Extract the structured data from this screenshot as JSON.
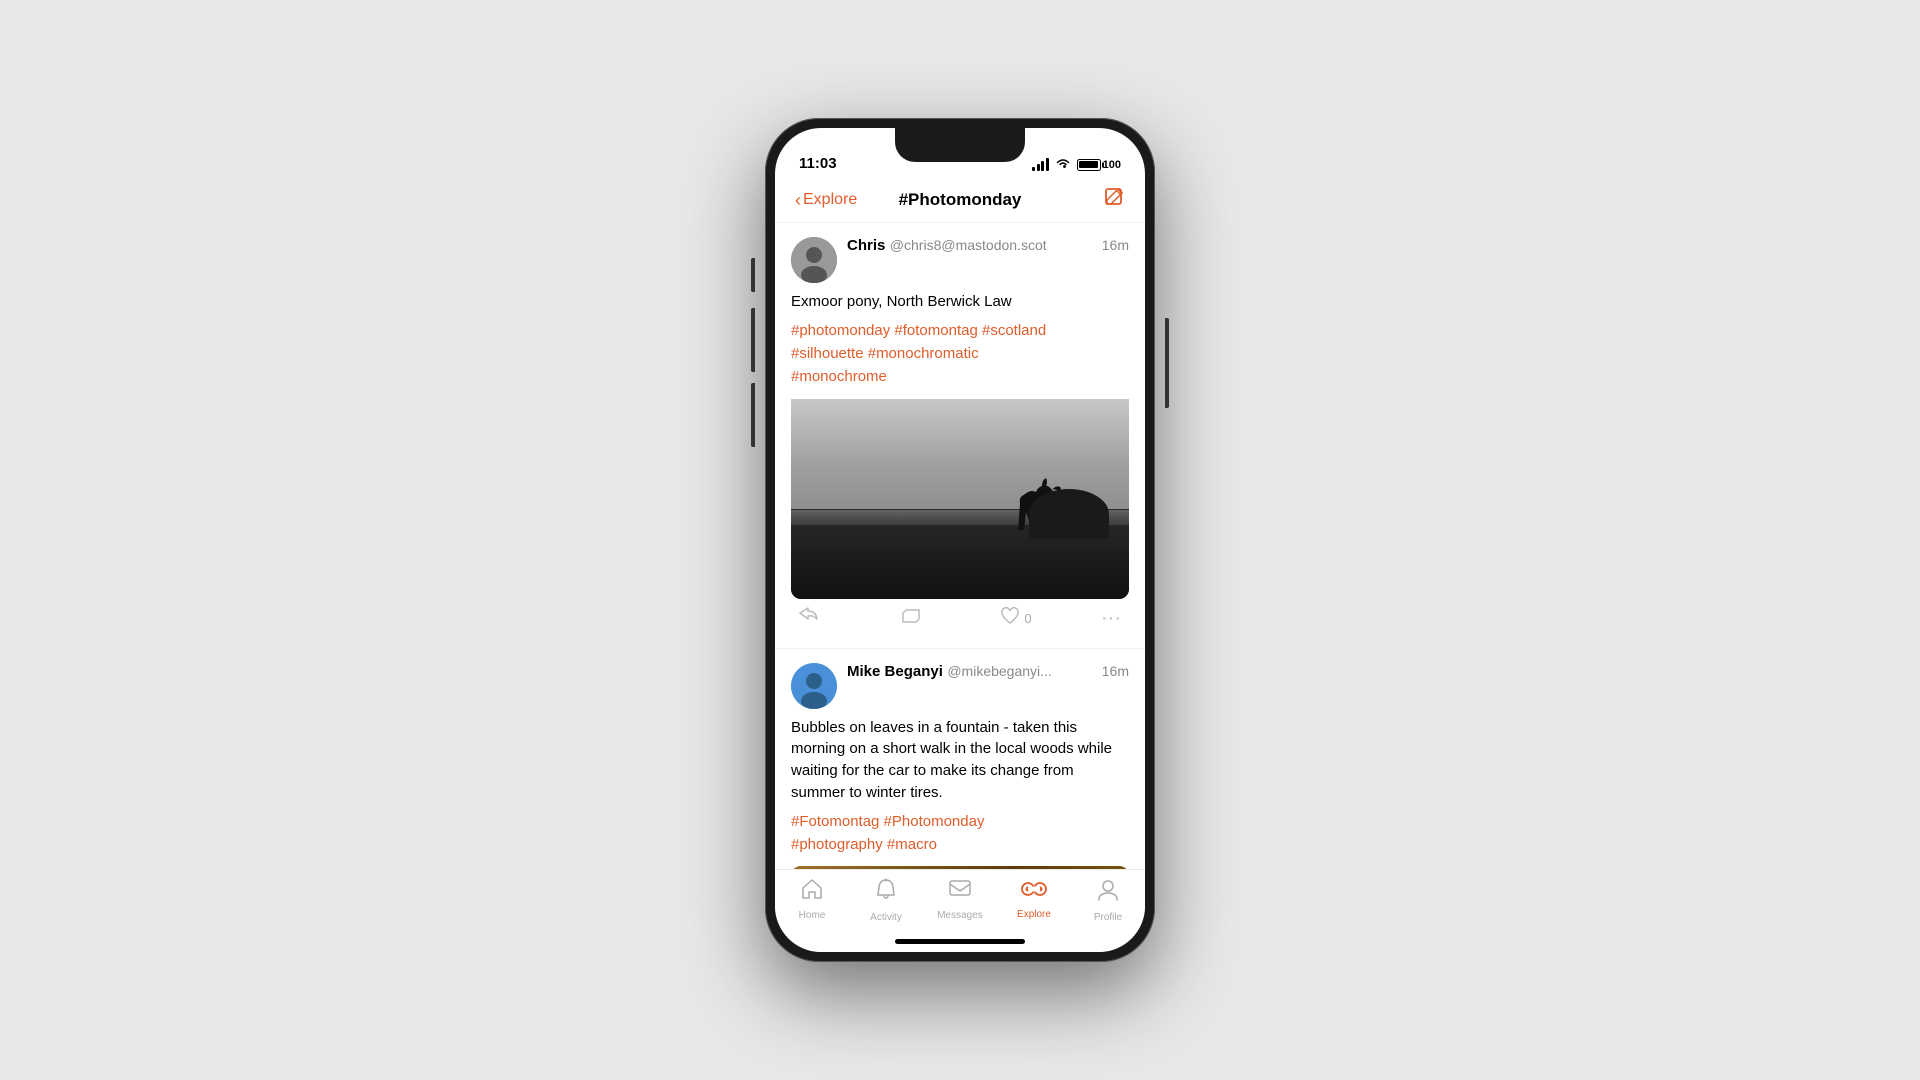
{
  "phone": {
    "status": {
      "time": "11:03",
      "battery_label": "100"
    },
    "nav": {
      "back_label": "Explore",
      "title": "#Photomonday"
    },
    "posts": [
      {
        "id": "post1",
        "name": "Chris",
        "handle": "@chris8@mastodon.scot",
        "time": "16m",
        "body": "Exmoor pony, North Berwick Law",
        "tags": "#photomonday #fotomontag #scotland\n#silhouette #monochromatic\n#monochrome",
        "has_image": true,
        "image_type": "horse",
        "like_count": "0"
      },
      {
        "id": "post2",
        "name": "Mike Beganyi",
        "handle": "@mikebeganyi...",
        "time": "16m",
        "body": "Bubbles on leaves in a fountain - taken this morning on a short walk in the local woods while waiting for the car to make its change from summer to winter tires.",
        "tags": "#Fotomontag #Photomonday\n#photography #macro",
        "has_image": true,
        "image_type": "macro"
      }
    ],
    "tabs": [
      {
        "id": "home",
        "label": "Home",
        "active": false,
        "icon": "home"
      },
      {
        "id": "activity",
        "label": "Activity",
        "active": false,
        "icon": "bell"
      },
      {
        "id": "messages",
        "label": "Messages",
        "active": false,
        "icon": "envelope"
      },
      {
        "id": "explore",
        "label": "Explore",
        "active": true,
        "icon": "binoculars"
      },
      {
        "id": "profile",
        "label": "Profile",
        "active": false,
        "icon": "person"
      }
    ]
  }
}
